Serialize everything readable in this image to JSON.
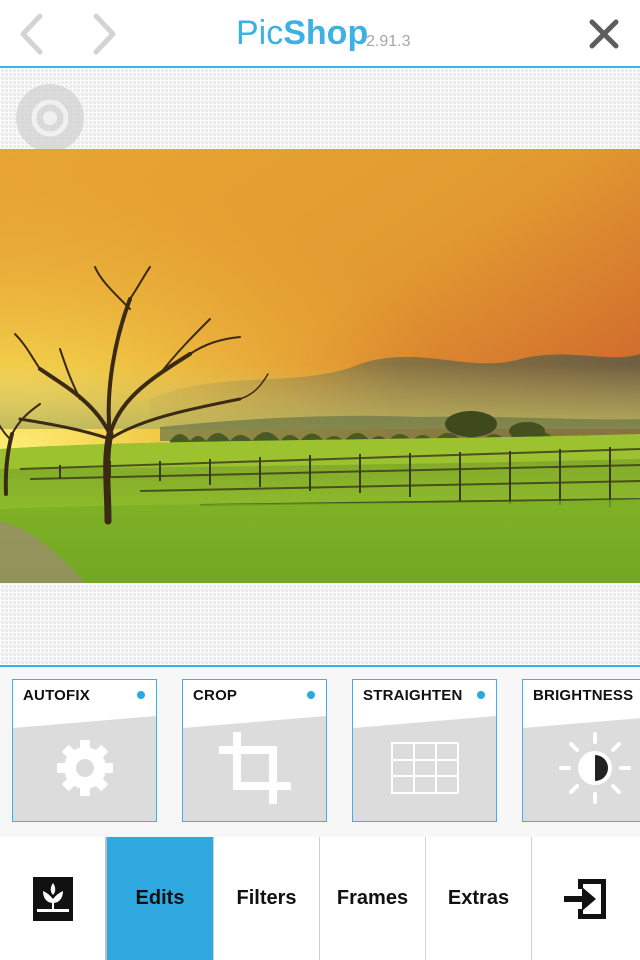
{
  "app": {
    "title_light": "Pic",
    "title_bold": "Shop",
    "version": "2.91.3"
  },
  "nav": {
    "back_icon": "chevron-left-icon",
    "forward_icon": "chevron-right-icon",
    "close_icon": "close-icon"
  },
  "canvas": {
    "compare_icon": "compare-icon",
    "photo_subject": "vineyard landscape at sunset"
  },
  "tools": [
    {
      "label": "AUTOFIX",
      "icon": "gear-icon"
    },
    {
      "label": "CROP",
      "icon": "crop-icon"
    },
    {
      "label": "STRAIGHTEN",
      "icon": "grid-icon"
    },
    {
      "label": "BRIGHTNESS",
      "icon": "brightness-icon"
    }
  ],
  "tabs": {
    "gallery_icon": "gallery-icon",
    "items": [
      {
        "label": "Edits",
        "active": true
      },
      {
        "label": "Filters",
        "active": false
      },
      {
        "label": "Frames",
        "active": false
      },
      {
        "label": "Extras",
        "active": false
      }
    ],
    "export_icon": "export-icon"
  },
  "colors": {
    "accent": "#3cb2e4",
    "active_tab": "#2ea8df",
    "indicator_dot": "#2aa9e0"
  }
}
